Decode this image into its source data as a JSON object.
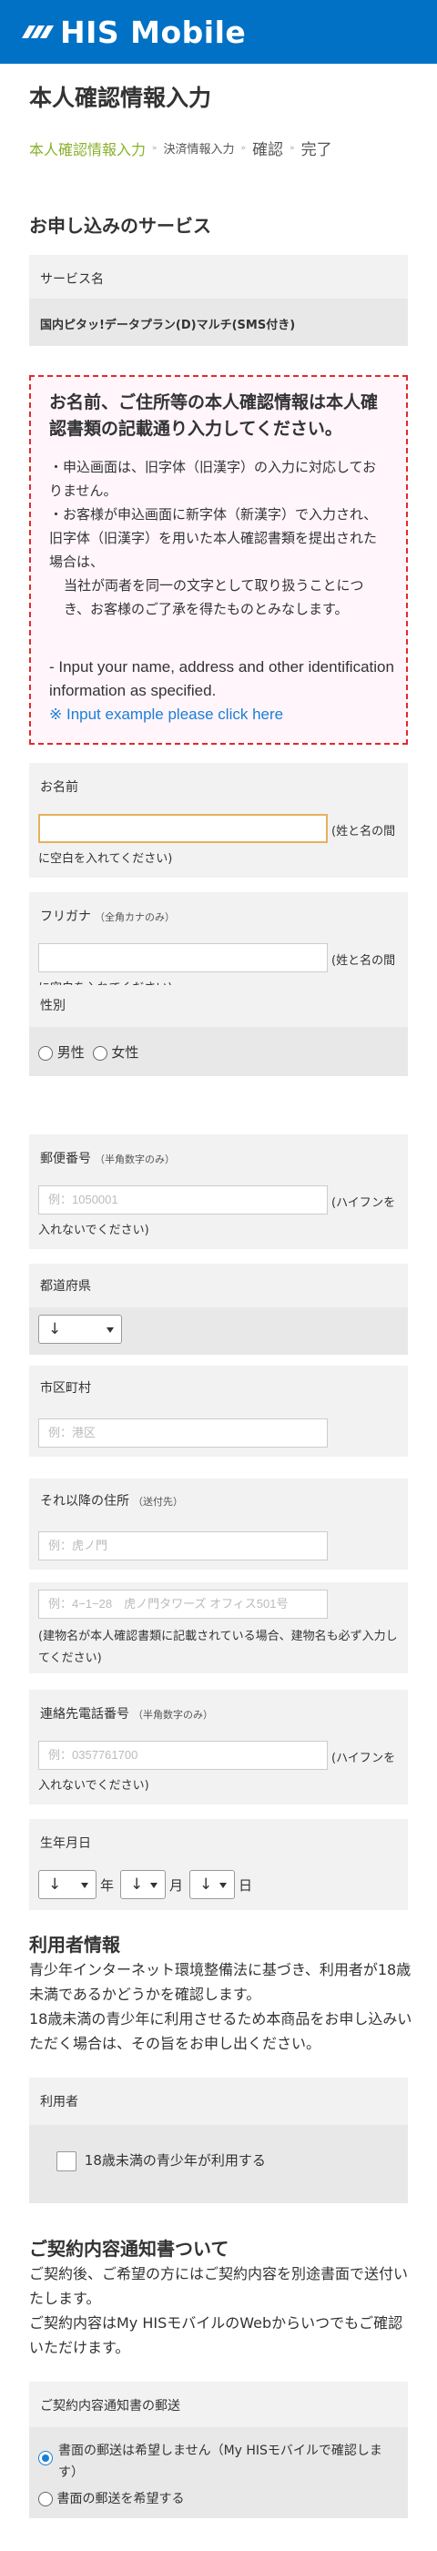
{
  "header": {
    "logo_text": "HIS Mobile",
    "brand_color": "#0071c5"
  },
  "page": {
    "title": "本人確認情報入力"
  },
  "breadcrumb": {
    "steps": [
      "本人確認情報入力",
      "決済情報入力",
      "確認",
      "完了"
    ],
    "active_color": "#8ab12c"
  },
  "service_section": {
    "title": "お申し込みのサービス",
    "label": "サービス名",
    "value": "国内ピタッ!データプラン(D)マルチ(SMS付き)"
  },
  "notice": {
    "title": "お名前、ご住所等の本人確認情報は本人確認書類の記載通り入力してください。",
    "bullet1": "・申込画面は、旧字体（旧漢字）の入力に対応しておりません。",
    "bullet2": "・お客様が申込画面に新字体（新漢字）で入力され、旧字体（旧漢字）を用いた本人確認書類を提出された場合は、",
    "bullet2_cont": "当社が両者を同一の文字として取り扱うことにつき、お客様のご了承を得たものとみなします。",
    "en_line": "- Input your name, address and other identification information as specified.",
    "en_link": "※ Input example please click here",
    "border_color": "#e02b2b"
  },
  "form": {
    "name": {
      "label": "お名前",
      "value": "",
      "note": "(姓と名の間に空白を入れてください)"
    },
    "furigana": {
      "label": "フリガナ",
      "hint": "（全角カナのみ）",
      "value": "",
      "note": "(姓と名の間に空白を入れてください)"
    },
    "gender": {
      "label": "性別",
      "male": "男性",
      "female": "女性"
    },
    "postal": {
      "label": "郵便番号",
      "hint": "（半角数字のみ）",
      "placeholder": "例：1050001",
      "note": "(ハイフンを入れないでください)"
    },
    "prefecture": {
      "label": "都道府県",
      "selected": "↓"
    },
    "city": {
      "label": "市区町村",
      "placeholder": "例：港区"
    },
    "town": {
      "label": "それ以降の住所",
      "hint": "（送付先）",
      "placeholder": "例：虎ノ門"
    },
    "building": {
      "placeholder": "例：4−1−28　虎ノ門タワーズ オフィス501号",
      "note": "(建物名が本人確認書類に記載されている場合、建物名も必ず入力してください)"
    },
    "phone": {
      "label": "連絡先電話番号",
      "hint": "（半角数字のみ）",
      "placeholder": "例：0357761700",
      "note": "(ハイフンを入れないでください)"
    },
    "birthday": {
      "label": "生年月日",
      "year_sel": "↓",
      "year": "年",
      "month_sel": "↓",
      "month": "月",
      "day_sel": "↓",
      "day": "日"
    }
  },
  "user_info": {
    "title": "利用者情報",
    "text1": "青少年インターネット環境整備法に基づき、利用者が18歳未満であるかどうかを確認します。",
    "text2": "18歳未満の青少年に利用させるため本商品をお申し込みいただく場合は、その旨をお申し出ください。",
    "label": "利用者",
    "checkbox": "18歳未満の青少年が利用する"
  },
  "contract": {
    "title": "ご契約内容通知書ついて",
    "text1": "ご契約後、ご希望の方にはご契約内容を別途書面で送付いたします。",
    "text2": "ご契約内容はMy HISモバイルのWebからいつでもご確認いただけます。",
    "label": "ご契約内容通知書の郵送",
    "option1": "書面の郵送は希望しません（My HISモバイルで確認します）",
    "option2": "書面の郵送を希望する"
  }
}
